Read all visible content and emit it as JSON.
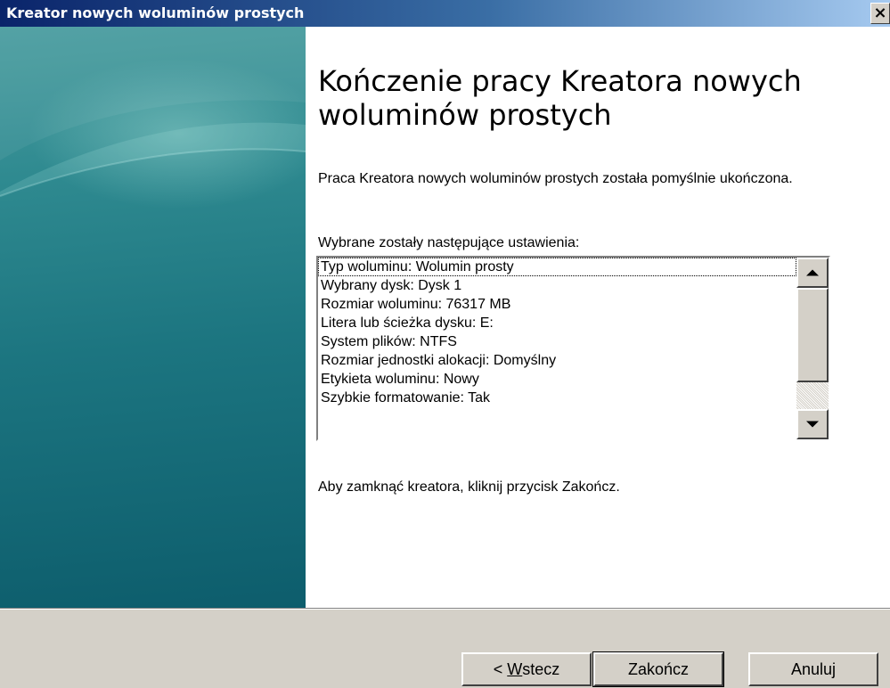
{
  "window": {
    "title": "Kreator nowych woluminów prostych",
    "close_label": "×"
  },
  "main": {
    "heading": "Kończenie pracy Kreatora nowych woluminów prostych",
    "completion_text": "Praca Kreatora nowych woluminów prostych została pomyślnie ukończona.",
    "settings_label": "Wybrane zostały następujące ustawienia:",
    "settings": [
      "Typ woluminu: Wolumin prosty",
      "Wybrany dysk: Dysk 1",
      "Rozmiar woluminu: 76317 MB",
      "Litera lub ścieżka dysku: E:",
      "System plików: NTFS",
      "Rozmiar jednostki alokacji: Domyślny",
      "Etykieta woluminu: Nowy",
      "Szybkie formatowanie: Tak"
    ],
    "close_instruction": "Aby zamknąć kreatora, kliknij przycisk Zakończ."
  },
  "buttons": {
    "back_prefix": "< ",
    "back_mnemonic": "W",
    "back_rest": "stecz",
    "finish": "Zakończ",
    "cancel": "Anuluj"
  },
  "icons": {
    "close": "close-icon",
    "scroll_up": "arrow-up-icon",
    "scroll_down": "arrow-down-icon"
  },
  "colors": {
    "title_bar": "#0a246a",
    "side_panel": "#1c7580",
    "dialog_face": "#d4d0c8"
  }
}
